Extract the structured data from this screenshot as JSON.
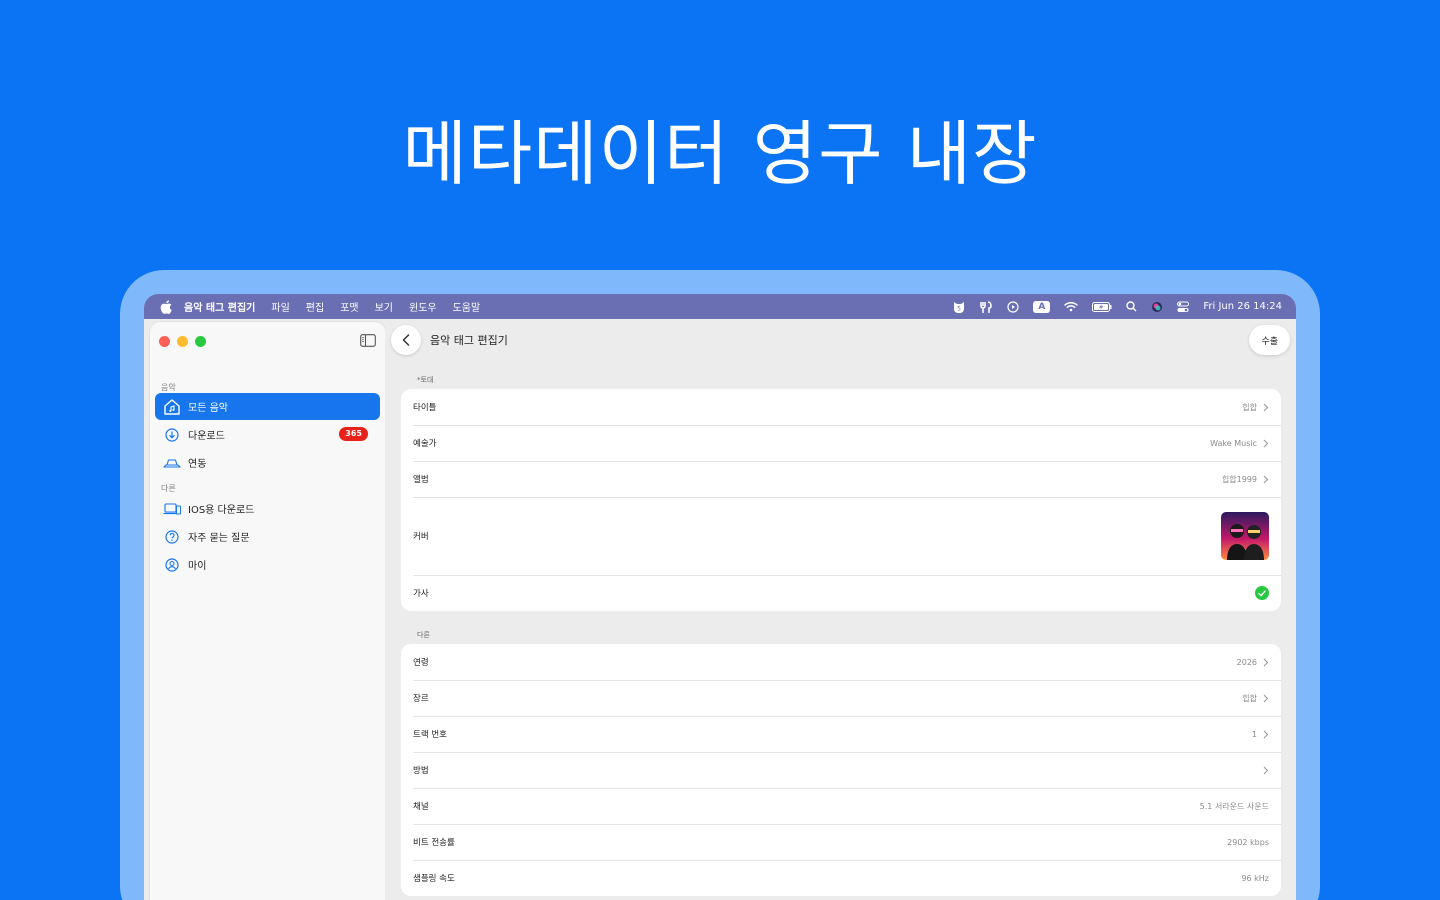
{
  "hero": {
    "title": "메타데이터 영구 내장"
  },
  "menubar": {
    "app_name": "음악 태그 편집기",
    "items": [
      "파일",
      "편집",
      "포맷",
      "보기",
      "윈도우",
      "도움말"
    ],
    "input_badge": "A",
    "clock": "Fri Jun 26  14:24"
  },
  "sidebar": {
    "section_music": "음악",
    "section_other": "다른",
    "items": [
      {
        "label": "모든 음악",
        "icon": "home-music-icon",
        "active": true
      },
      {
        "label": "다운로드",
        "icon": "download-icon",
        "badge": "365"
      },
      {
        "label": "연동",
        "icon": "cloud-sync-icon"
      },
      {
        "label": "IOS용 다운로드",
        "icon": "laptop-phone-icon"
      },
      {
        "label": "자주 묻는 질문",
        "icon": "question-icon"
      },
      {
        "label": "마이",
        "icon": "person-icon"
      }
    ]
  },
  "main": {
    "title": "음악 태그 편집기",
    "export_label": "수출",
    "basic_label": "*토대",
    "other_label": "다른",
    "basic_rows": [
      {
        "label": "타이틀",
        "value": "힙합"
      },
      {
        "label": "예술가",
        "value": "Wake Music"
      },
      {
        "label": "앨범",
        "value": "힙합1999"
      },
      {
        "label": "커버",
        "value": ""
      },
      {
        "label": "가사",
        "value": ""
      }
    ],
    "other_rows": [
      {
        "label": "연령",
        "value": "2026"
      },
      {
        "label": "장르",
        "value": "힙합"
      },
      {
        "label": "트랙 번호",
        "value": "1"
      },
      {
        "label": "방법",
        "value": ""
      },
      {
        "label": "채널",
        "value": "5.1 서라운드 사운드"
      },
      {
        "label": "비트 전송률",
        "value": "2902 kbps"
      },
      {
        "label": "샘플링 속도",
        "value": "96 kHz"
      }
    ]
  },
  "colors": {
    "background": "#0a74f5",
    "accent": "#1776ee",
    "badge": "#e8211a",
    "check": "#28c840",
    "menubar": "#6a6fb4"
  }
}
